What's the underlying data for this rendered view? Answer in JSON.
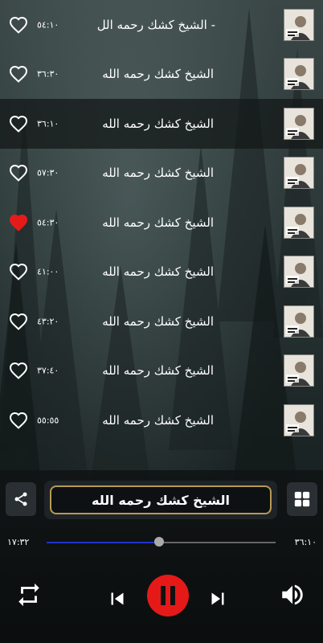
{
  "playlist": [
    {
      "title": "- الشيخ كشك رحمه الل",
      "duration": "٥٤:١٠",
      "favorite": false,
      "active": false
    },
    {
      "title": "الشيخ كشك رحمه الله",
      "duration": "٣٦:٣٠",
      "favorite": false,
      "active": false
    },
    {
      "title": "الشيخ كشك رحمه الله",
      "duration": "٣٦:١٠",
      "favorite": false,
      "active": true
    },
    {
      "title": "الشيخ كشك رحمه الله",
      "duration": "٥٧:٣٠",
      "favorite": false,
      "active": false
    },
    {
      "title": "الشيخ كشك رحمه الله",
      "duration": "٥٤:٣٠",
      "favorite": true,
      "active": false
    },
    {
      "title": "الشيخ كشك رحمه الله",
      "duration": "٤١:٠٠",
      "favorite": false,
      "active": false
    },
    {
      "title": "الشيخ كشك رحمه الله",
      "duration": "٤٣:٢٠",
      "favorite": false,
      "active": false
    },
    {
      "title": "الشيخ كشك رحمه الله",
      "duration": "٣٧:٤٠",
      "favorite": false,
      "active": false
    },
    {
      "title": "الشيخ كشك رحمه الله",
      "duration": "٥٥:٥٥",
      "favorite": false,
      "active": false
    }
  ],
  "thumbnail_icon": "sheikh-kishk-album-art",
  "player": {
    "now_playing_title": "الشيخ كشك رحمه الله",
    "elapsed": "١٧:٣٢",
    "total": "٣٦:١٠",
    "progress": 0.49,
    "share_icon": "share-icon",
    "grid_icon": "grid-icon",
    "repeat_icon": "repeat-icon",
    "previous_icon": "skip-previous-icon",
    "pause_icon": "pause-icon",
    "next_icon": "skip-next-icon",
    "volume_icon": "volume-icon"
  },
  "colors": {
    "favorite": "#e51b1b",
    "pause_button": "#e61919",
    "progress_fill": "#2233cc",
    "now_playing_border": "#b89a52"
  }
}
